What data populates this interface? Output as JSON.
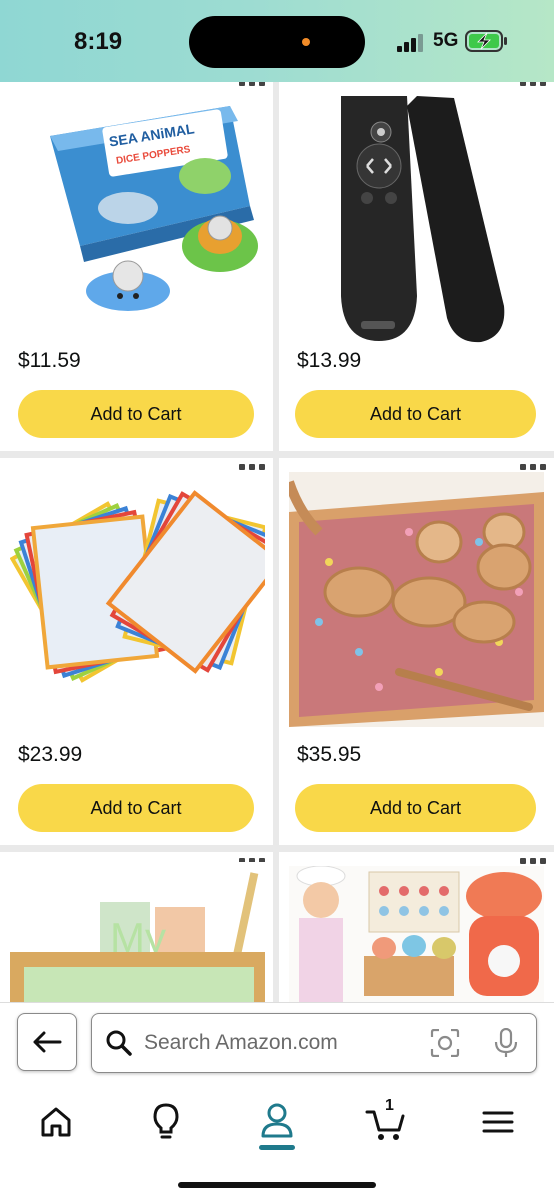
{
  "status_bar": {
    "time": "8:19",
    "network": "5G",
    "signal_icon": "cellular-signal-icon",
    "battery_icon": "battery-charging-icon"
  },
  "products": [
    {
      "price": "$11.59",
      "add_label": "Add to Cart",
      "box_text": [
        "SEA ANiMAL",
        "DICE POPPERS"
      ]
    },
    {
      "price": "$13.99",
      "add_label": "Add to Cart"
    },
    {
      "price": "$23.99",
      "add_label": "Add to Cart"
    },
    {
      "price": "$35.95",
      "add_label": "Add to Cart"
    },
    {
      "image_text": "My"
    },
    {}
  ],
  "search": {
    "placeholder": "Search Amazon.com",
    "back_icon": "arrow-left-icon",
    "search_icon": "magnifier-icon",
    "camera_icon": "camera-lens-icon",
    "mic_icon": "microphone-icon"
  },
  "tabbar": {
    "cart_count": "1",
    "active_tab": "profile",
    "accent": "#1f7a8c"
  },
  "colors": {
    "add_to_cart": "#f9d849",
    "status_gradient": "#8fd7d3"
  }
}
